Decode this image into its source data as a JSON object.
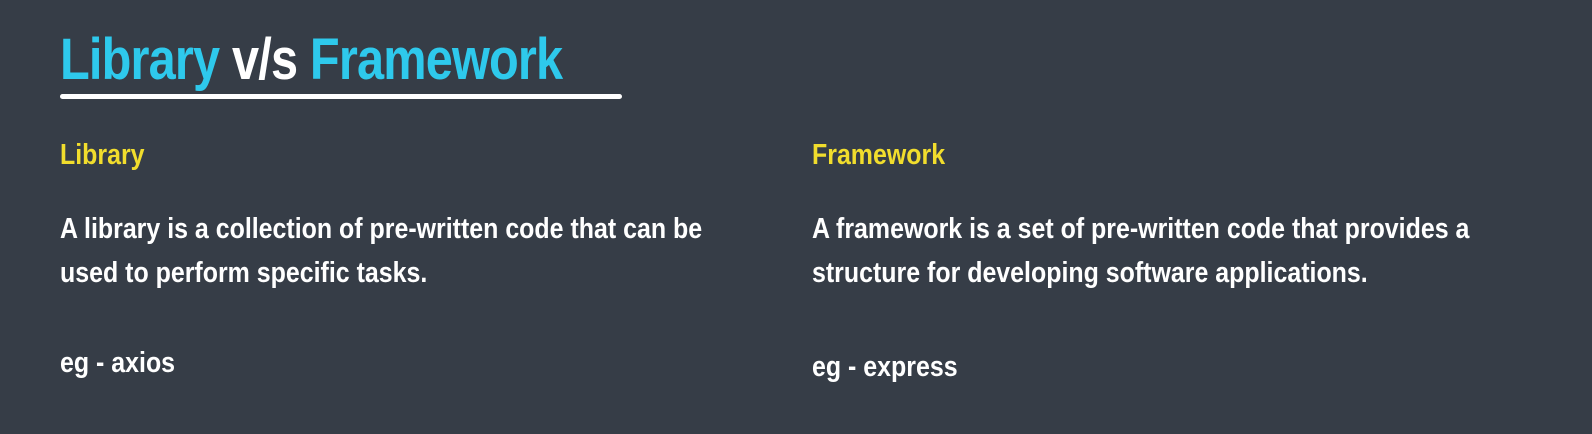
{
  "title": {
    "left_word": "Library",
    "middle_word": "v/s",
    "right_word": "Framework"
  },
  "columns": [
    {
      "heading": "Library",
      "description": "A library is a collection of pre-written code that can be used to perform specific tasks.",
      "example": "eg - axios"
    },
    {
      "heading": "Framework",
      "description": "A framework is a set of pre-written code that provides a structure for developing software applications.",
      "example": "eg - express"
    }
  ],
  "colors": {
    "background": "#363d47",
    "title_accent": "#2ec9ec",
    "heading": "#f1dd2d",
    "body_text": "#ffffff"
  }
}
